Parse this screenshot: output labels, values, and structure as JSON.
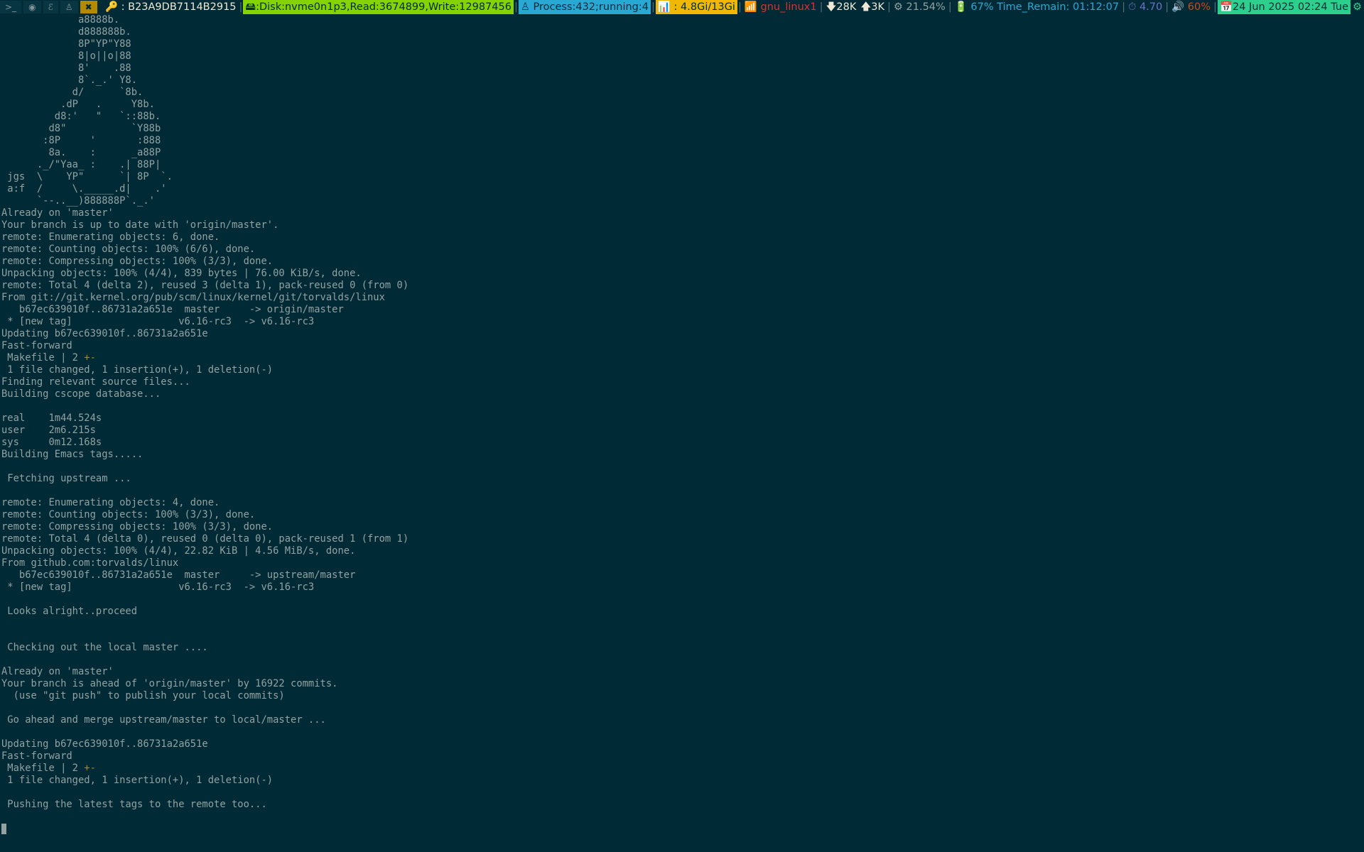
{
  "statusbar": {
    "workspaces": [
      {
        "label": ">_",
        "icon": "terminal-icon",
        "active": false
      },
      {
        "label": "◉",
        "icon": "firefox-icon",
        "active": false
      },
      {
        "label": "ℰ",
        "icon": "emacs-icon",
        "active": false
      },
      {
        "label": "♙",
        "icon": "tux-icon",
        "active": false
      },
      {
        "label": "✖",
        "icon": "tools-icon",
        "active": true
      }
    ],
    "key": "🔑 : B23A9DB7114B2915",
    "disk": "🖴:Disk:nvme0n1p3,Read:3674899,Write:12987456",
    "process": "♙ Process:432;running:4",
    "memory": "📊 : 4.8Gi/13Gi",
    "wifi": "📶 gnu_linux1",
    "net_down": "🡇28K",
    "net_up": "🡅3K",
    "cpu": "⚙ 21.54%",
    "battery": "🔋 67% Time_Remain: 01:12:07",
    "load": "⏱ 4.70",
    "volume": "🔊 60%",
    "date": "📅24 Jun 2025 02:24 Tue",
    "tray": "⚙",
    "colors": {
      "background": "#002b36",
      "disk": "#85d400",
      "process": "#2aa8d4",
      "memory": "#f0b800",
      "date": "#2cd08c",
      "wifi": "#dc322f"
    }
  },
  "terminal": {
    "lines": [
      "             a8888b.",
      "             d888888b.",
      "             8P\"YP\"Y88",
      "             8|o||o|88",
      "             8'    .88",
      "             8`._.' Y8.",
      "            d/      `8b.",
      "          .dP   .     Y8b.",
      "         d8:'   \"   `::88b.",
      "        d8\"           `Y88b",
      "       :8P     '       :888",
      "        8a.    :      _a88P",
      "      ._/\"Yaa_ :    .| 88P|",
      " jgs  \\    YP\"      `| 8P  `.",
      " a:f  /     \\._____.d|    .'",
      "      `--..__)888888P`._.'",
      "Already on 'master'",
      "Your branch is up to date with 'origin/master'.",
      "remote: Enumerating objects: 6, done.",
      "remote: Counting objects: 100% (6/6), done.",
      "remote: Compressing objects: 100% (3/3), done.",
      "Unpacking objects: 100% (4/4), 839 bytes | 76.00 KiB/s, done.",
      "remote: Total 4 (delta 2), reused 3 (delta 1), pack-reused 0 (from 0)",
      "From git://git.kernel.org/pub/scm/linux/kernel/git/torvalds/linux",
      "   b67ec639010f..86731a2a651e  master     -> origin/master",
      " * [new tag]                  v6.16-rc3  -> v6.16-rc3",
      "Updating b67ec639010f..86731a2a651e",
      "Fast-forward",
      " Makefile | 2 +-",
      " 1 file changed, 1 insertion(+), 1 deletion(-)",
      "Finding relevant source files...",
      "Building cscope database...",
      "",
      "real    1m44.524s",
      "user    2m6.215s",
      "sys     0m12.168s",
      "Building Emacs tags.....",
      "",
      " Fetching upstream ...",
      "",
      "remote: Enumerating objects: 4, done.",
      "remote: Counting objects: 100% (3/3), done.",
      "remote: Compressing objects: 100% (3/3), done.",
      "remote: Total 4 (delta 0), reused 0 (delta 0), pack-reused 1 (from 1)",
      "Unpacking objects: 100% (4/4), 22.82 KiB | 4.56 MiB/s, done.",
      "From github.com:torvalds/linux",
      "   b67ec639010f..86731a2a651e  master     -> upstream/master",
      " * [new tag]                  v6.16-rc3  -> v6.16-rc3",
      "",
      " Looks alright..proceed",
      "",
      "",
      " Checking out the local master ....",
      "",
      "Already on 'master'",
      "Your branch is ahead of 'origin/master' by 16922 commits.",
      "  (use \"git push\" to publish your local commits)",
      "",
      " Go ahead and merge upstream/master to local/master ...",
      "",
      "Updating b67ec639010f..86731a2a651e",
      "Fast-forward",
      " Makefile | 2 +-",
      " 1 file changed, 1 insertion(+), 1 deletion(-)",
      "",
      " Pushing the latest tags to the remote too...",
      ""
    ]
  }
}
